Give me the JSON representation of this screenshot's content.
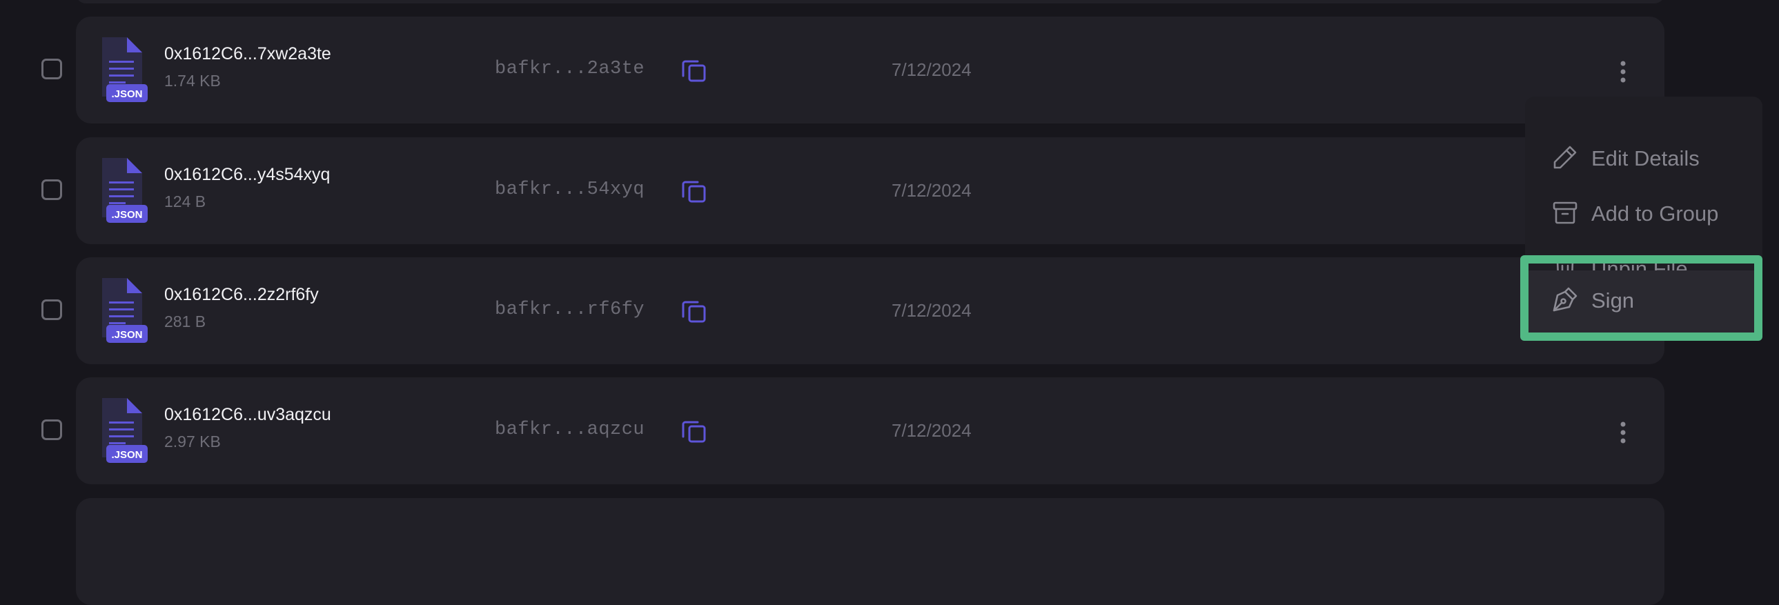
{
  "files": [
    {
      "name": "0x1612C6...7xw2a3te",
      "size": "1.74 KB",
      "cid": "bafkr...2a3te",
      "date": "7/12/2024",
      "badge": ".JSON"
    },
    {
      "name": "0x1612C6...y4s54xyq",
      "size": "124 B",
      "cid": "bafkr...54xyq",
      "date": "7/12/2024",
      "badge": ".JSON"
    },
    {
      "name": "0x1612C6...2z2rf6fy",
      "size": "281 B",
      "cid": "bafkr...rf6fy",
      "date": "7/12/2024",
      "badge": ".JSON"
    },
    {
      "name": "0x1612C6...uv3aqzcu",
      "size": "2.97 KB",
      "cid": "bafkr...aqzcu",
      "date": "7/12/2024",
      "badge": ".JSON"
    }
  ],
  "menu": {
    "items": [
      {
        "label": "Edit Details",
        "icon": "pencil-icon"
      },
      {
        "label": "Add to Group",
        "icon": "archive-icon"
      },
      {
        "label": "Unpin File",
        "icon": "trash-icon"
      },
      {
        "label": "Sign",
        "icon": "pen-nib-icon"
      }
    ],
    "highlighted": "Sign"
  },
  "colors": {
    "accent": "#5e55d9",
    "highlight": "#52b985",
    "background": "#17161c",
    "row": "#212027"
  }
}
